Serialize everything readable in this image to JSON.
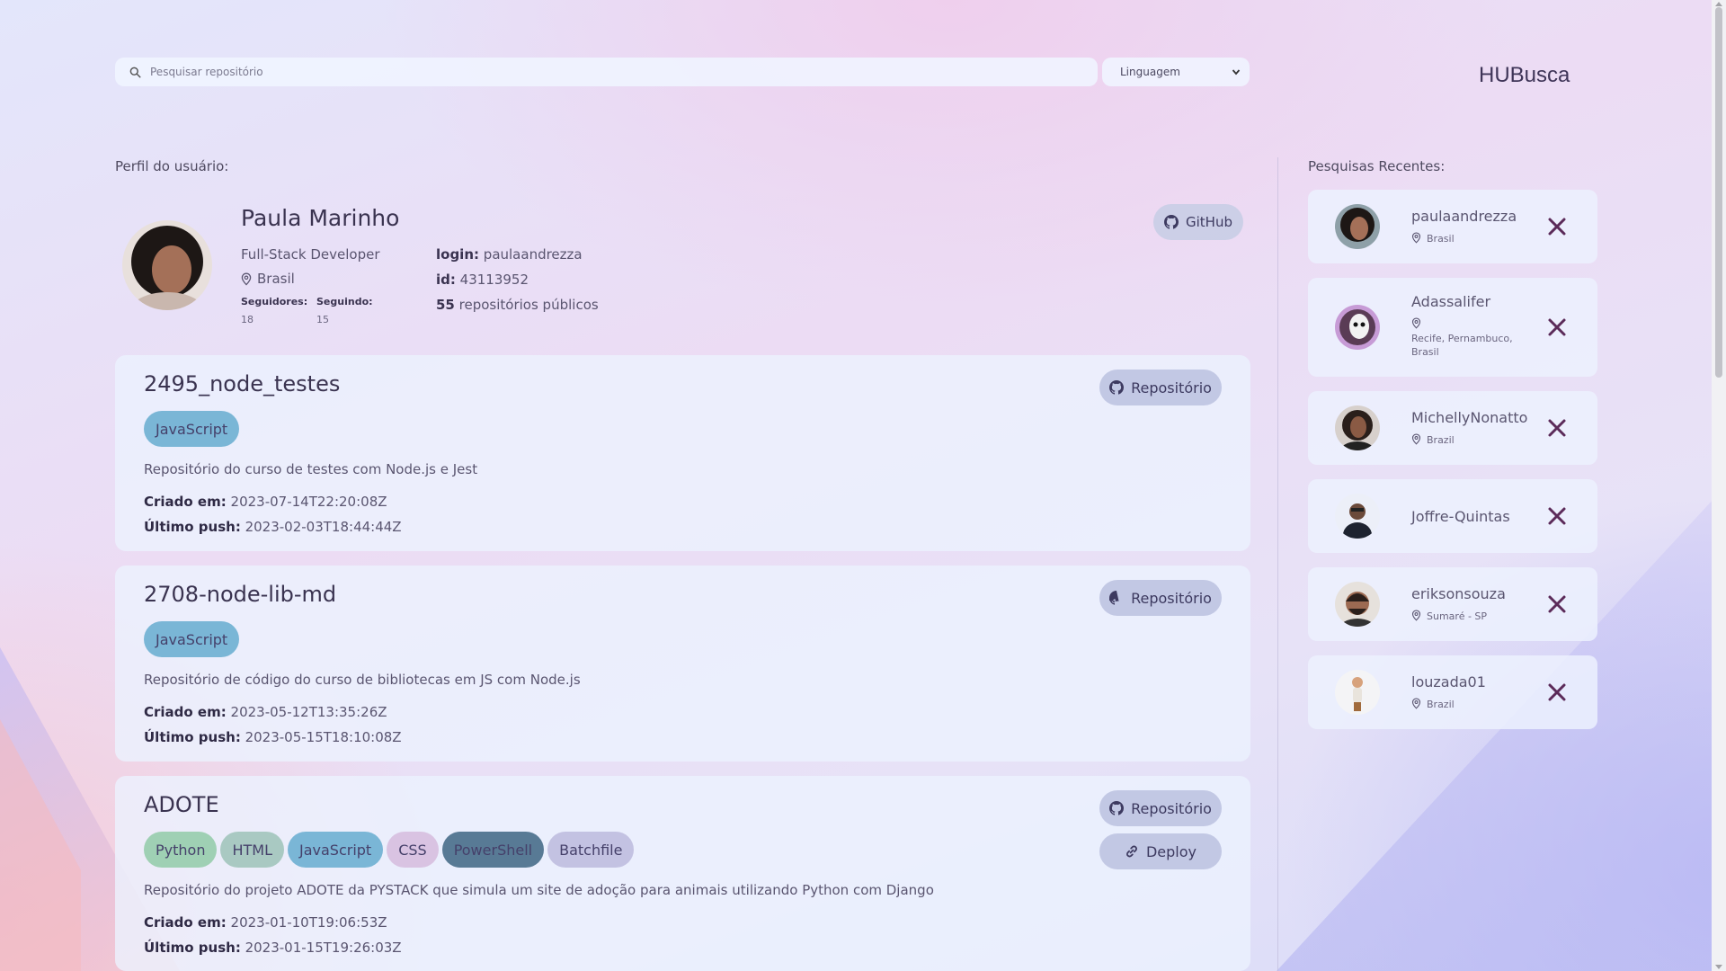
{
  "search": {
    "placeholder": "Pesquisar repositório"
  },
  "language_select": {
    "selected": "Linguagem"
  },
  "brand": "HUBusca",
  "profile": {
    "section_label": "Perfil do usuário:",
    "name": "Paula Marinho",
    "role": "Full-Stack Developer",
    "location": "Brasil",
    "followers_label": "Seguidores:",
    "followers": "18",
    "following_label": "Seguindo:",
    "following": "15",
    "login_label": "login:",
    "login": "paulaandrezza",
    "id_label": "id:",
    "id": "43113952",
    "repos_count": "55",
    "repos_text": "repositórios públicos",
    "github_button": "GitHub"
  },
  "repo_labels": {
    "repo_button": "Repositório",
    "deploy_button": "Deploy",
    "created_label": "Criado em:",
    "pushed_label": "Último push:"
  },
  "repos": [
    {
      "name": "2495_node_testes",
      "tags": [
        "JavaScript"
      ],
      "description": "Repositório do curso de testes com Node.js e Jest",
      "created": "2023-07-14T22:20:08Z",
      "pushed": "2023-02-03T18:44:44Z"
    },
    {
      "name": "2708-node-lib-md",
      "tags": [
        "JavaScript"
      ],
      "description": "Repositório de código do curso de bibliotecas em JS com Node.js",
      "created": "2023-05-12T13:35:26Z",
      "pushed": "2023-05-15T18:10:08Z"
    },
    {
      "name": "ADOTE",
      "tags": [
        "Python",
        "HTML",
        "JavaScript",
        "CSS",
        "PowerShell",
        "Batchfile"
      ],
      "description": "Repositório do projeto ADOTE da PYSTACK que simula um site de adoção para animais utilizando Python com Django",
      "created": "2023-01-10T19:06:53Z",
      "pushed": "2023-01-15T19:26:03Z"
    }
  ],
  "tag_colors": {
    "JavaScript": "#7ab6d6",
    "Python": "#9fd0b4",
    "HTML": "#a9c9c2",
    "CSS": "#d9c3e2",
    "PowerShell": "#587a95",
    "Batchfile": "#c3c2e2"
  },
  "recent": {
    "section_label": "Pesquisas Recentes:",
    "items": [
      {
        "name": "paulaandrezza",
        "location": "Brasil"
      },
      {
        "name": "Adassalifer",
        "location": "Recife, Pernambuco, Brasil"
      },
      {
        "name": "MichellyNonatto",
        "location": "Brazil"
      },
      {
        "name": "Joffre-Quintas",
        "location": ""
      },
      {
        "name": "eriksonsouza",
        "location": "Sumaré - SP"
      },
      {
        "name": "louzada01",
        "location": "Brazil"
      }
    ]
  },
  "colors": {
    "accent_close": "#5b2a59",
    "text_dark": "#3a3350"
  }
}
